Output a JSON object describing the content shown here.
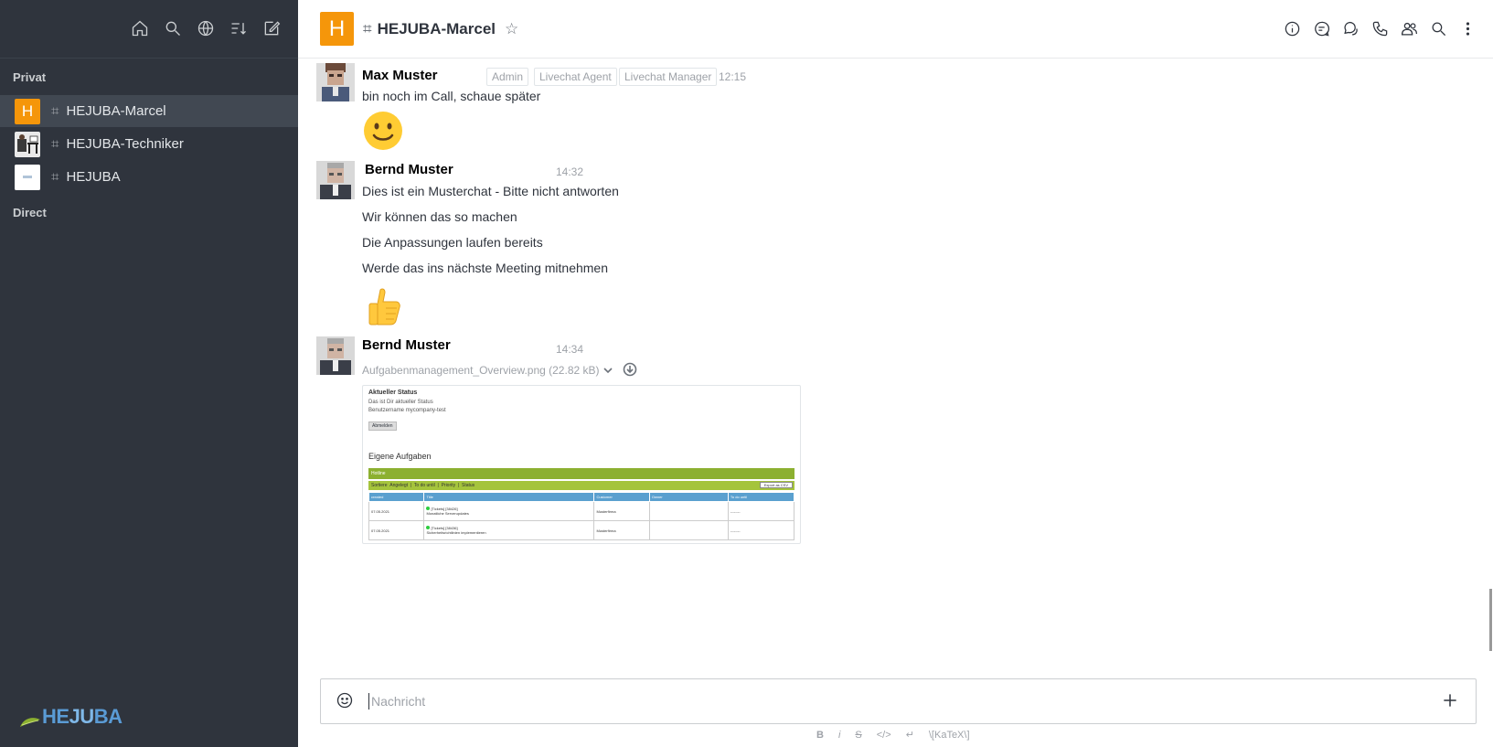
{
  "sidebar": {
    "section_private": "Privat",
    "section_direct": "Direct",
    "rooms": [
      {
        "initial": "H",
        "name": "HEJUBA-Marcel"
      },
      {
        "initial": "",
        "name": "HEJUBA-Techniker"
      },
      {
        "initial": "",
        "name": "HEJUBA"
      }
    ],
    "logo": {
      "part1": "HE",
      "part2": "JU",
      "part3": "BA"
    }
  },
  "header": {
    "avatar_initial": "H",
    "title": "HEJUBA-Marcel",
    "hash": "#",
    "star": "☆"
  },
  "messages": [
    {
      "author": "Max Muster",
      "roles": [
        "Admin",
        "Livechat Agent",
        "Livechat Manager"
      ],
      "time": "12:15",
      "lines": [
        "bin noch im Call, schaue später"
      ],
      "emoji": "slightly-smiling-face"
    },
    {
      "author": "Bernd Muster",
      "time": "14:32",
      "lines": [
        "Dies ist ein Musterchat - Bitte nicht antworten",
        "Wir können das so machen",
        "Die Anpassungen laufen bereits",
        "Werde das ins nächste Meeting mitnehmen"
      ],
      "emoji": "thumbs-up"
    },
    {
      "author": "Bernd Muster",
      "time": "14:34",
      "file": {
        "name": "Aufgabenmanagement_Overview.png (22.82 kB)"
      }
    }
  ],
  "attachment_preview": {
    "heading": "Aktueller Status",
    "line1": "Das ist Dir aktueller Status",
    "line2": "Benutzername mycompany-test",
    "button": "Abmelden",
    "heading2": "Eigene Aufgaben",
    "green_bar": "Hotline",
    "toolbar": [
      "Sortiere",
      "Angelegt",
      "To do until",
      "Priority",
      "Status"
    ],
    "export": "Export as CSV",
    "columns": [
      "created",
      "Title",
      "Customer",
      "Owner",
      "To do until"
    ],
    "rows": [
      {
        "created": "07.05.2021",
        "ticket": "[Tickets] [38426]",
        "title": "Monatliche Serverupdates",
        "customer": "Musterfirma",
        "owner": "",
        "todo": "--------"
      },
      {
        "created": "07.05.2021",
        "ticket": "[Tickets] [38436]",
        "title": "Sicherheitsrichtlinien implementieren",
        "customer": "Musterfirma",
        "owner": "",
        "todo": "--------"
      }
    ]
  },
  "composer": {
    "placeholder": "Nachricht",
    "format": {
      "bold": "B",
      "italic": "i",
      "strike": "S",
      "code": "</>",
      "multiline": "↵",
      "katex": "\\[KaTeX\\]"
    }
  },
  "colors": {
    "sidebar_bg": "#2f343d",
    "sidebar_active": "#414852",
    "accent_orange": "#f5960a"
  }
}
